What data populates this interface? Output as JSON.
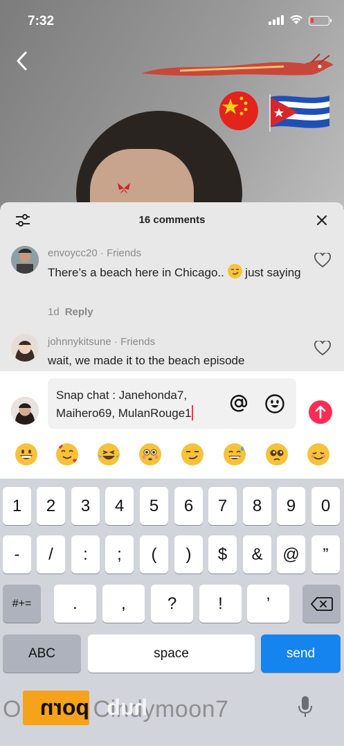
{
  "status": {
    "time": "7:32"
  },
  "comments_panel": {
    "title": "16 comments",
    "comments": [
      {
        "username": "envoycc20",
        "relation": "Friends",
        "text_before_emoji": "There’s a beach here in Chicago.. ",
        "emoji": "smirk-emoji",
        "text_after_emoji": " just saying",
        "age": "1d",
        "reply": "Reply"
      },
      {
        "username": "johnnykitsune",
        "relation": "Friends",
        "text": "wait, we made it to the beach episode"
      }
    ],
    "meta_separator": " · "
  },
  "composer": {
    "value_line1": "Snap chat : Janehonda7,",
    "value_line2": "Maihero69, MulanRouge1"
  },
  "emoji_bar": [
    "grinning-emoji",
    "smiling-hearts-emoji",
    "laughing-tears-emoji",
    "flushed-emoji",
    "smirk-emoji",
    "sweat-smile-emoji",
    "pleading-emoji",
    "relieved-emoji"
  ],
  "keyboard": {
    "row1": [
      "1",
      "2",
      "3",
      "4",
      "5",
      "6",
      "7",
      "8",
      "9",
      "0"
    ],
    "row2": [
      "-",
      "/",
      ":",
      ";",
      "(",
      ")",
      "$",
      "&",
      "@",
      "”"
    ],
    "row3": [
      ".",
      ",",
      "?",
      "!",
      "’"
    ],
    "symbols_key": "#+=",
    "abc_key": "ABC",
    "space_key": "space",
    "send_key": "send"
  },
  "background_caption": "O        s.c m Cindymoon7",
  "watermark": {
    "part1": "porn",
    "part2": "hub"
  }
}
